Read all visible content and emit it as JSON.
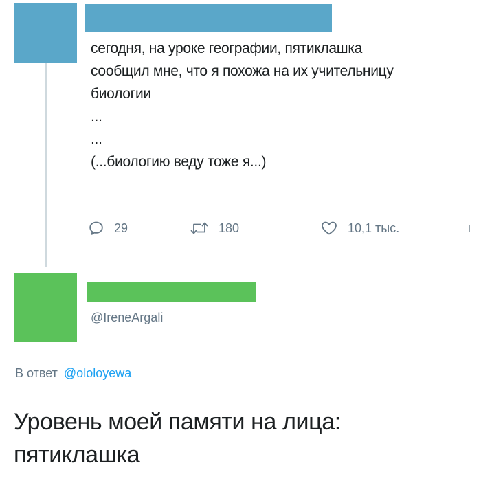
{
  "tweet1": {
    "text_lines": [
      "сегодня, на уроке географии, пятиклашка",
      "сообщил мне, что я похожа на их учительницу",
      "биологии",
      "...",
      "...",
      "(...биологию веду тоже я...)"
    ],
    "actions": {
      "reply_count": "29",
      "retweet_count": "180",
      "like_count": "10,1 тыс."
    }
  },
  "tweet2": {
    "handle": "@IreneArgali",
    "reply_prefix": "В ответ",
    "reply_mention": "@ololoyewa",
    "text_lines": [
      "Уровень моей памяти на лица:",
      "пятиклашка"
    ]
  },
  "colors": {
    "avatar1": "#5aa7c9",
    "avatar2": "#5bc25a",
    "mention": "#1da1f2",
    "muted": "#657786"
  },
  "icons": {
    "reply": "reply-icon",
    "retweet": "retweet-icon",
    "like": "heart-icon"
  }
}
